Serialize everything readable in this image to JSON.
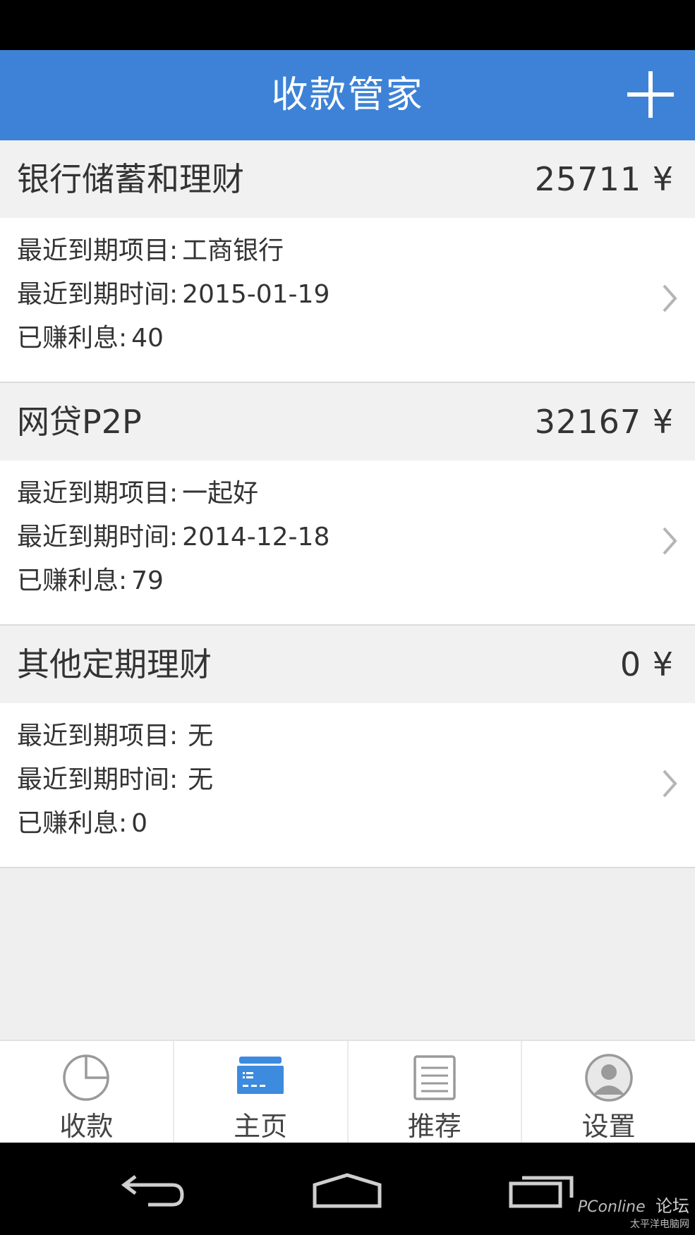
{
  "header": {
    "title": "收款管家"
  },
  "sections": [
    {
      "name": "银行储蓄和理财",
      "total": "25711 ¥",
      "rows": [
        {
          "label": "最近到期项目:",
          "value": "工商银行"
        },
        {
          "label": "最近到期时间:",
          "value": "2015-01-19"
        },
        {
          "label": "已赚利息:",
          "value": "40"
        }
      ]
    },
    {
      "name": "网贷P2P",
      "total": "32167 ¥",
      "rows": [
        {
          "label": "最近到期项目:",
          "value": "一起好"
        },
        {
          "label": "最近到期时间:",
          "value": "2014-12-18"
        },
        {
          "label": "已赚利息:",
          "value": "79"
        }
      ]
    },
    {
      "name": "其他定期理财",
      "total": "0 ¥",
      "rows": [
        {
          "label": "最近到期项目:",
          "value": "无"
        },
        {
          "label": "最近到期时间:",
          "value": "无"
        },
        {
          "label": "已赚利息:",
          "value": "0"
        }
      ]
    }
  ],
  "tabs": [
    {
      "label": "收款",
      "icon": "pie-chart-icon"
    },
    {
      "label": "主页",
      "icon": "card-icon",
      "active": true
    },
    {
      "label": "推荐",
      "icon": "list-doc-icon"
    },
    {
      "label": "设置",
      "icon": "user-avatar-icon"
    }
  ],
  "watermark": {
    "brand": "PConline",
    "sub": "太平洋电脑网",
    "forum": "论坛"
  },
  "colors": {
    "accent": "#3d82d6",
    "section_bg": "#f1f1f1",
    "tab_active": "#3d8bde"
  }
}
